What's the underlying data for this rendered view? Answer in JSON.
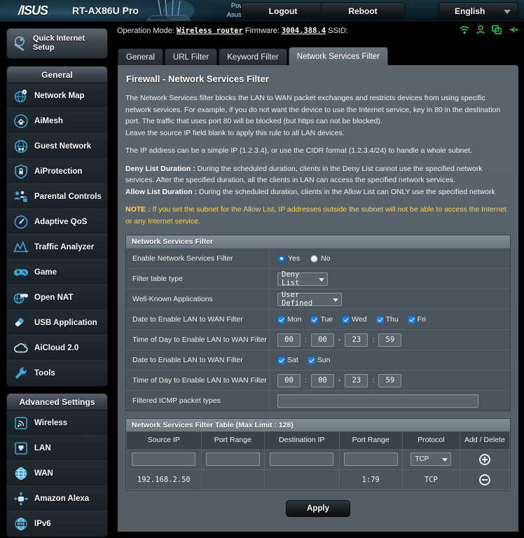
{
  "header": {
    "brand": "/ISUS",
    "model": "RT-AX86U Pro",
    "powered_by_line1": "Powered by",
    "powered_by_line2": "Asuswrt-Merlin",
    "logout_label": "Logout",
    "reboot_label": "Reboot",
    "language": "English",
    "status_icons": [
      "wifi-icon",
      "user-icon",
      "devices-icon",
      "usb-icon"
    ],
    "accent_green": "#2dd24f"
  },
  "opbar": {
    "operation_mode_label": "Operation Mode:",
    "operation_mode_value": "Wireless router",
    "firmware_label": "Firmware:",
    "firmware_value": "3004.388.4",
    "ssid_label": "SSID:",
    "ssid_value": ""
  },
  "sidebar": {
    "quick_setup": "Quick Internet Setup",
    "groups": [
      {
        "title": "General",
        "items": [
          {
            "label": "Network Map",
            "icon": "network-map-icon"
          },
          {
            "label": "AiMesh",
            "icon": "aimesh-icon"
          },
          {
            "label": "Guest Network",
            "icon": "guest-network-icon"
          },
          {
            "label": "AiProtection",
            "icon": "shield-icon"
          },
          {
            "label": "Parental Controls",
            "icon": "parental-controls-icon"
          },
          {
            "label": "Adaptive QoS",
            "icon": "gauge-icon"
          },
          {
            "label": "Traffic Analyzer",
            "icon": "traffic-analyzer-icon"
          },
          {
            "label": "Game",
            "icon": "gamepad-icon"
          },
          {
            "label": "Open NAT",
            "icon": "open-nat-icon"
          },
          {
            "label": "USB Application",
            "icon": "usb-application-icon"
          },
          {
            "label": "AiCloud 2.0",
            "icon": "cloud-icon"
          },
          {
            "label": "Tools",
            "icon": "wrench-icon"
          }
        ]
      },
      {
        "title": "Advanced Settings",
        "items": [
          {
            "label": "Wireless",
            "icon": "wireless-icon"
          },
          {
            "label": "LAN",
            "icon": "lan-icon"
          },
          {
            "label": "WAN",
            "icon": "wan-icon"
          },
          {
            "label": "Amazon Alexa",
            "icon": "amazon-alexa-icon"
          },
          {
            "label": "IPv6",
            "icon": "ipv6-icon"
          }
        ]
      }
    ]
  },
  "tabs": [
    {
      "label": "General",
      "active": false
    },
    {
      "label": "URL Filter",
      "active": false
    },
    {
      "label": "Keyword Filter",
      "active": false
    },
    {
      "label": "Network Services Filter",
      "active": true
    }
  ],
  "page": {
    "title": "Firewall - Network Services Filter",
    "desc_p1": "The Network Services filter blocks the LAN to WAN packet exchanges and restricts devices from using specific network services. For example, if you do not want the device to use the Internet service, key in 80 in the destination port. The traffic that uses port 80 will be blocked (but https can not be blocked).",
    "desc_p2": "Leave the source IP field blank to apply this rule to all LAN devices.",
    "desc_p3": "The IP address can be a simple IP (1.2.3.4), or use the CIDR format (1.2.3.4/24) to handle a whole subnet.",
    "deny_label": "Deny List Duration :",
    "deny_text": " During the scheduled duration, clients in the Deny List cannot use the specified network services. After the specified duration, all the clients in LAN can access the specified network services.",
    "allow_label": "Allow List Duration :",
    "allow_text": " During the scheduled duration, clients in the Allow List can ONLY use the specified network",
    "note_label": "NOTE :",
    "note_text": " If you set the subnet for the Allow List, IP addresses outside the subnet will not be able to access the Internet or any Internet service.",
    "note_color": "#ffd24a"
  },
  "settings": {
    "section_title": "Network Services Filter",
    "enable": {
      "label": "Enable Network Services Filter",
      "yes_label": "Yes",
      "no_label": "No",
      "selected": "Yes"
    },
    "filter_table_type": {
      "label": "Filter table type",
      "value": "Deny List"
    },
    "well_known_apps": {
      "label": "Well-Known Applications",
      "value": "User Defined"
    },
    "date_weekday": {
      "label": "Date to Enable LAN to WAN Filter",
      "days": [
        {
          "label": "Mon",
          "checked": true
        },
        {
          "label": "Tue",
          "checked": true
        },
        {
          "label": "Wed",
          "checked": true
        },
        {
          "label": "Thu",
          "checked": true
        },
        {
          "label": "Fri",
          "checked": true
        }
      ]
    },
    "time_weekday": {
      "label": "Time of Day to Enable LAN to WAN Filter",
      "start_hour": "00",
      "start_min": "00",
      "end_hour": "23",
      "end_min": "59",
      "colon": ":",
      "dash": "-"
    },
    "date_weekend": {
      "label": "Date to Enable LAN to WAN Filter",
      "days": [
        {
          "label": "Sat",
          "checked": true
        },
        {
          "label": "Sun",
          "checked": true
        }
      ]
    },
    "time_weekend": {
      "label": "Time of Day to Enable LAN to WAN Filter",
      "start_hour": "00",
      "start_min": "00",
      "end_hour": "23",
      "end_min": "59"
    },
    "icmp": {
      "label": "Filtered ICMP packet types",
      "value": ""
    }
  },
  "filter_table": {
    "section_title": "Network Services Filter Table (Max Limit : 128)",
    "columns": [
      "Source IP",
      "Port Range",
      "Destination IP",
      "Port Range",
      "Protocol",
      "Add / Delete"
    ],
    "new_row": {
      "source_ip": "",
      "port_range_src": "",
      "destination_ip": "",
      "port_range_dst": "",
      "protocol": "TCP",
      "action_icon": "plus-icon"
    },
    "rows": [
      {
        "source_ip": "192.168.2.50",
        "port_range_src": "",
        "destination_ip": "",
        "port_range_dst": "1:79",
        "protocol": "TCP",
        "action_icon": "minus-icon"
      }
    ]
  },
  "apply_label": "Apply"
}
